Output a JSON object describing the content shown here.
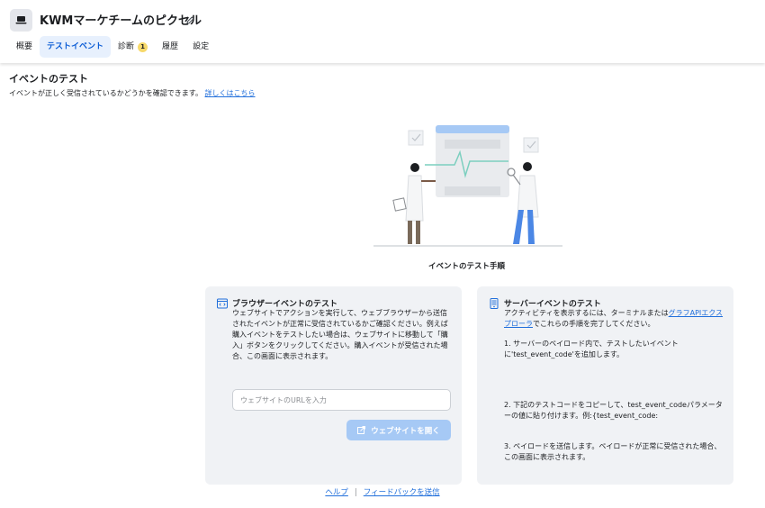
{
  "header": {
    "title": "KWMマーケチームのピクセル",
    "app_icon": "laptop-icon",
    "edit_icon": "pencil-icon"
  },
  "tabs": [
    {
      "label": "概要"
    },
    {
      "label": "テストイベント",
      "active": true
    },
    {
      "label": "診断",
      "badge": "1"
    },
    {
      "label": "履歴"
    },
    {
      "label": "設定"
    }
  ],
  "section": {
    "title": "イベントのテスト",
    "desc": "イベントが正しく受信されているかどうかを確認できます。",
    "learn_more": "詳しくはこちら"
  },
  "illustration": {
    "caption": "イベントのテスト手順"
  },
  "browser_card": {
    "title": "ブラウザーイベントのテスト",
    "text": "ウェブサイトでアクションを実行して、ウェブブラウザーから送信されたイベントが正常に受信されているかご確認ください。例えば購入イベントをテストしたい場合は、ウェブサイトに移動して「購入」ボタンをクリックしてください。購入イベントが受信された場合、この画面に表示されます。",
    "input_placeholder": "ウェブサイトのURLを入力",
    "open_button": "ウェブサイトを開く"
  },
  "server_card": {
    "title": "サーバーイベントのテスト",
    "intro_before": "アクティビティを表示するには、ターミナルまたは",
    "intro_link": "グラフAPIエクスプローラ",
    "intro_after": "でこれらの手順を完了してください。",
    "step1": "1. サーバーのペイロード内で、テストしたいイベントに'test_event_code'を追加します。",
    "step2": "2. 下記のテストコードをコピーして、test_event_codeパラメーターの値に貼り付けます。例:{test_event_code:",
    "step3": "3. ペイロードを送信します。ペイロードが正常に受信された場合、この画面に表示されます。"
  },
  "footer": {
    "help": "ヘルプ",
    "separator": "|",
    "feedback": "フィードバックを送信"
  },
  "colors": {
    "accent": "#0b5cd5",
    "link": "#216fdb",
    "active_tab_bg": "#e7f0fd",
    "card_bg": "#f0f2f5",
    "button_disabled": "#a6c9f5",
    "badge": "#f7d96b"
  }
}
